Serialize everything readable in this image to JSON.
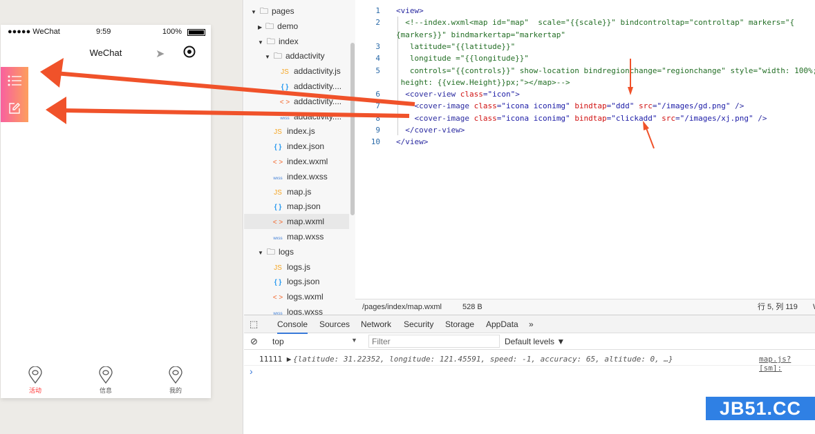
{
  "phone": {
    "carrier": "●●●●● WeChat",
    "time": "9:59",
    "battery": "100%",
    "nav_title": "WeChat",
    "tabs": [
      {
        "label": "活动",
        "active": true
      },
      {
        "label": "信息"
      },
      {
        "label": "我的"
      }
    ]
  },
  "tree": [
    {
      "label": "pages",
      "type": "folder",
      "open": true,
      "depth": 0
    },
    {
      "label": "demo",
      "type": "folder",
      "open": false,
      "depth": 1
    },
    {
      "label": "index",
      "type": "folder",
      "open": true,
      "depth": 1
    },
    {
      "label": "addactivity",
      "type": "folder",
      "open": true,
      "depth": 2
    },
    {
      "label": "addactivity.js",
      "type": "js",
      "depth": 3
    },
    {
      "label": "addactivity....",
      "type": "json",
      "depth": 3
    },
    {
      "label": "addactivity....",
      "type": "wxml",
      "depth": 3
    },
    {
      "label": "addactivity....",
      "type": "wxss",
      "depth": 3
    },
    {
      "label": "index.js",
      "type": "js",
      "depth": 2
    },
    {
      "label": "index.json",
      "type": "json",
      "depth": 2
    },
    {
      "label": "index.wxml",
      "type": "wxml",
      "depth": 2
    },
    {
      "label": "index.wxss",
      "type": "wxss",
      "depth": 2
    },
    {
      "label": "map.js",
      "type": "js",
      "depth": 2
    },
    {
      "label": "map.json",
      "type": "json",
      "depth": 2
    },
    {
      "label": "map.wxml",
      "type": "wxml",
      "depth": 2,
      "selected": true
    },
    {
      "label": "map.wxss",
      "type": "wxss",
      "depth": 2
    },
    {
      "label": "logs",
      "type": "folder",
      "open": true,
      "depth": 1
    },
    {
      "label": "logs.js",
      "type": "js",
      "depth": 2
    },
    {
      "label": "logs.json",
      "type": "json",
      "depth": 2
    },
    {
      "label": "logs.wxml",
      "type": "wxml",
      "depth": 2
    },
    {
      "label": "logs.wxss",
      "type": "wxss",
      "depth": 2
    }
  ],
  "code": [
    {
      "n": "1",
      "segs": [
        [
          "t",
          "<view>"
        ]
      ]
    },
    {
      "n": "2",
      "segs": [
        [
          "g",
          "  <!--index.wxml<map id=\"map\"  scale=\"{{scale}}\" bindcontroltap=\"controltap\" markers=\"{"
        ]
      ]
    },
    {
      "n": "",
      "segs": [
        [
          "g",
          "{markers}}\" bindmarkertap=\"markertap\""
        ]
      ]
    },
    {
      "n": "3",
      "segs": [
        [
          "g",
          "   latitude=\"{{latitude}}\""
        ]
      ]
    },
    {
      "n": "4",
      "segs": [
        [
          "g",
          "   longitude =\"{{longitude}}\""
        ]
      ]
    },
    {
      "n": "5",
      "segs": [
        [
          "g",
          "   controls=\"{{controls}}\" show-location bindregionchange=\"regionchange\" style=\"width: 100%;"
        ]
      ]
    },
    {
      "n": "",
      "segs": [
        [
          "g",
          " height: {{view.Height}}px;\"></map>-->"
        ]
      ]
    },
    {
      "n": "6",
      "segs": [
        [
          "t",
          "  <cover-view "
        ],
        [
          "a",
          "class"
        ],
        [
          "t",
          "="
        ],
        [
          "v",
          "\"icon\""
        ],
        [
          "t",
          ">"
        ]
      ]
    },
    {
      "n": "7",
      "segs": [
        [
          "t",
          "    <cover-image "
        ],
        [
          "a",
          "class"
        ],
        [
          "t",
          "="
        ],
        [
          "v",
          "\"icona iconimg\""
        ],
        [
          "t",
          " "
        ],
        [
          "a",
          "bindtap"
        ],
        [
          "t",
          "="
        ],
        [
          "v",
          "\"ddd\""
        ],
        [
          "t",
          " "
        ],
        [
          "a",
          "src"
        ],
        [
          "t",
          "="
        ],
        [
          "v",
          "\"/images/gd.png\""
        ],
        [
          "t",
          " />"
        ]
      ]
    },
    {
      "n": "8",
      "segs": [
        [
          "t",
          "    <cover-image "
        ],
        [
          "a",
          "class"
        ],
        [
          "t",
          "="
        ],
        [
          "v",
          "\"icona iconimg\""
        ],
        [
          "t",
          " "
        ],
        [
          "a",
          "bindtap"
        ],
        [
          "t",
          "="
        ],
        [
          "v",
          "\"clickadd\""
        ],
        [
          "t",
          " "
        ],
        [
          "a",
          "src"
        ],
        [
          "t",
          "="
        ],
        [
          "v",
          "\"/images/xj.png\""
        ],
        [
          "t",
          " />"
        ]
      ]
    },
    {
      "n": "9",
      "segs": [
        [
          "t",
          "  </cover-view>"
        ]
      ]
    },
    {
      "n": "10",
      "segs": [
        [
          "t",
          "</view>"
        ]
      ]
    }
  ],
  "status": {
    "path": "/pages/index/map.wxml",
    "size": "528 B",
    "position": "行 5, 列 119",
    "extra": "W"
  },
  "devtools": {
    "tabs": [
      "Console",
      "Sources",
      "Network",
      "Security",
      "Storage",
      "AppData",
      "»"
    ],
    "active": "Console",
    "context": "top",
    "filter_placeholder": "Filter",
    "levels": "Default levels ▼",
    "log": {
      "prefix": "11111 ▶",
      "text": "{latitude: 31.22352, longitude: 121.45591, speed: -1, accuracy: 65, altitude: 0, …}",
      "source": "map.js? [sm]:"
    },
    "prompt": "›"
  },
  "watermark": "JB51.CC",
  "colors": {
    "arrow": "#f0522a",
    "button_gradient": [
      "#f8609f",
      "#fd9f5d"
    ],
    "active_tab": "#ff3333",
    "watermark": "#2f80e4"
  }
}
